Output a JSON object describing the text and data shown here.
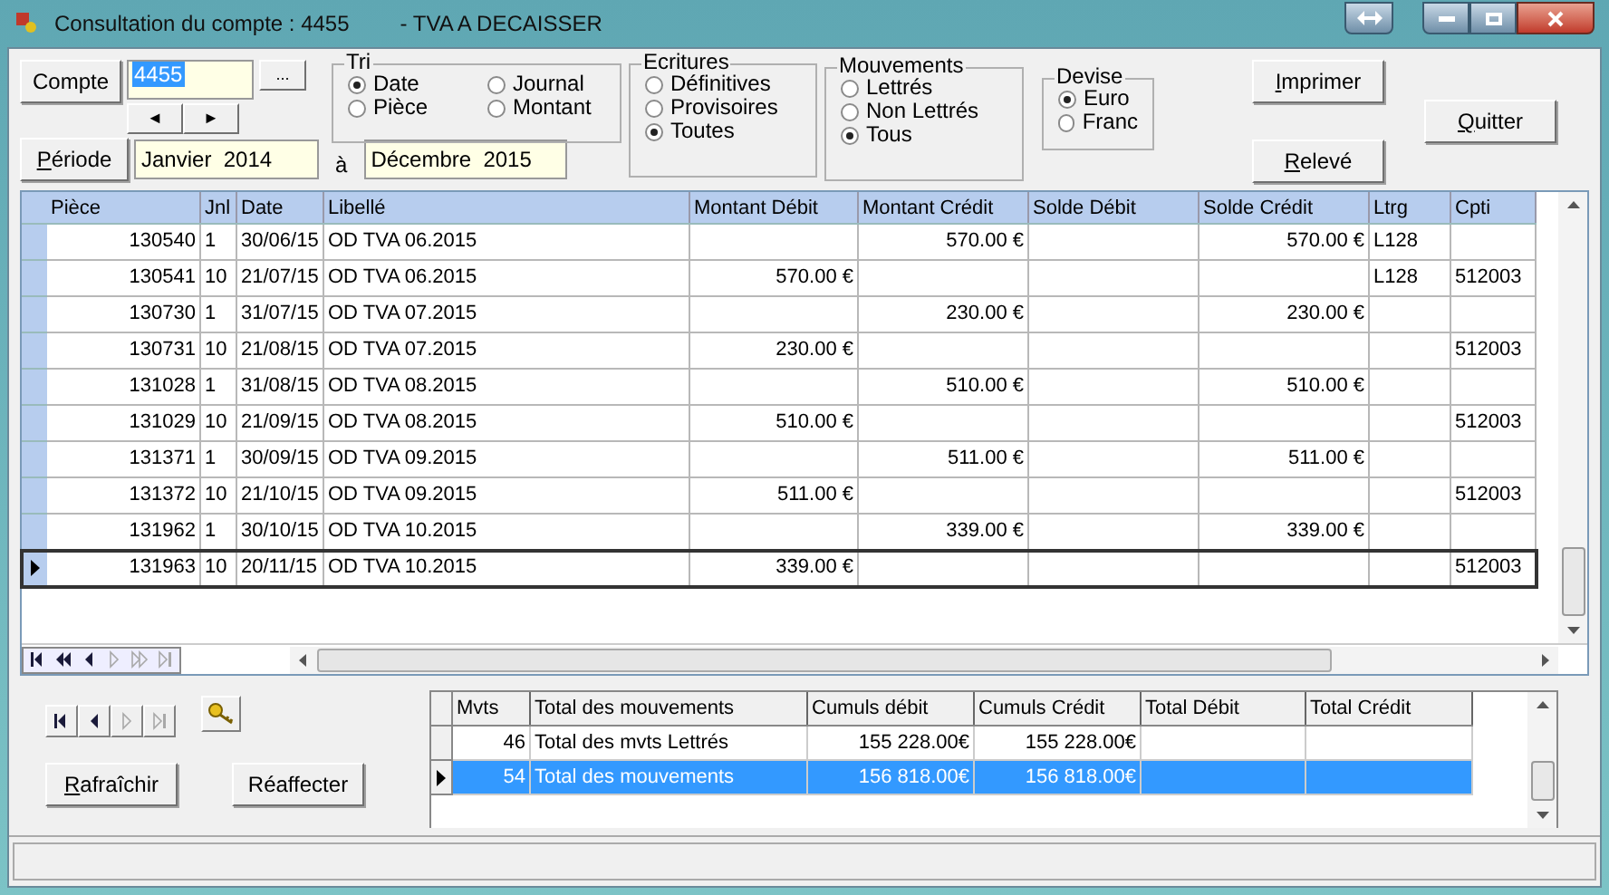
{
  "window": {
    "title": "Consultation du compte : 4455",
    "subtitle": "- TVA A DECAISSER"
  },
  "compte": {
    "button": {
      "label": "Compte",
      "mnemonic": false
    },
    "value": "4455",
    "text_selected": true,
    "browse": "...",
    "prev": "◄",
    "next": "►"
  },
  "periode": {
    "button": {
      "label": "Période",
      "mnemonic": true
    },
    "from": "Janvier  2014",
    "separator": "à",
    "to": "Décembre  2015"
  },
  "tri": {
    "title": "Tri",
    "options": [
      {
        "label": "Date",
        "selected": true
      },
      {
        "label": "Journal",
        "selected": false
      },
      {
        "label": "Pièce",
        "selected": false
      },
      {
        "label": "Montant",
        "selected": false
      }
    ]
  },
  "ecritures": {
    "title": "Ecritures",
    "options": [
      {
        "label": "Définitives",
        "selected": false
      },
      {
        "label": "Provisoires",
        "selected": false
      },
      {
        "label": "Toutes",
        "selected": true
      }
    ]
  },
  "mouvements": {
    "title": "Mouvements",
    "options": [
      {
        "label": "Lettrés",
        "selected": false
      },
      {
        "label": "Non Lettrés",
        "selected": false
      },
      {
        "label": "Tous",
        "selected": true
      }
    ]
  },
  "devise": {
    "title": "Devise",
    "options": [
      {
        "label": "Euro",
        "selected": true
      },
      {
        "label": "Franc",
        "selected": false
      }
    ]
  },
  "buttons": [
    {
      "label": "Imprimer",
      "mnemonic": true
    },
    {
      "label": "Relevé",
      "mnemonic": true
    },
    {
      "label": "Quitter",
      "mnemonic": true
    }
  ],
  "table": {
    "columns": [
      {
        "label": "Pièce",
        "kind": "number"
      },
      {
        "label": "Jnl",
        "kind": "text"
      },
      {
        "label": "Date",
        "kind": "text"
      },
      {
        "label": "Libellé",
        "kind": "text"
      },
      {
        "label": "Montant Débit",
        "kind": "number"
      },
      {
        "label": "Montant Crédit",
        "kind": "number"
      },
      {
        "label": "Solde Débit",
        "kind": "number"
      },
      {
        "label": "Solde Crédit",
        "kind": "number"
      },
      {
        "label": "Ltrg",
        "kind": "text"
      },
      {
        "label": "Cpti",
        "kind": "text"
      }
    ],
    "rows": [
      {
        "selected": false,
        "cells": [
          "130540",
          "1",
          "30/06/15",
          "OD TVA 06.2015",
          null,
          "570.00 €",
          null,
          "570.00 €",
          "L128",
          null
        ]
      },
      {
        "selected": false,
        "cells": [
          "130541",
          "10",
          "21/07/15",
          "OD TVA  06.2015",
          "570.00 €",
          null,
          null,
          null,
          "L128",
          "512003"
        ]
      },
      {
        "selected": false,
        "cells": [
          "130730",
          "1",
          "31/07/15",
          "OD TVA 07.2015",
          null,
          "230.00 €",
          null,
          "230.00 €",
          null,
          null
        ]
      },
      {
        "selected": false,
        "cells": [
          "130731",
          "10",
          "21/08/15",
          "OD TVA 07.2015",
          "230.00 €",
          null,
          null,
          null,
          null,
          "512003"
        ]
      },
      {
        "selected": false,
        "cells": [
          "131028",
          "1",
          "31/08/15",
          "OD TVA 08.2015",
          null,
          "510.00 €",
          null,
          "510.00 €",
          null,
          null
        ]
      },
      {
        "selected": false,
        "cells": [
          "131029",
          "10",
          "21/09/15",
          "OD TVA 08.2015",
          "510.00 €",
          null,
          null,
          null,
          null,
          "512003"
        ]
      },
      {
        "selected": false,
        "cells": [
          "131371",
          "1",
          "30/09/15",
          "OD TVA 09.2015",
          null,
          "511.00 €",
          null,
          "511.00 €",
          null,
          null
        ]
      },
      {
        "selected": false,
        "cells": [
          "131372",
          "10",
          "21/10/15",
          "OD TVA 09.2015",
          "511.00 €",
          null,
          null,
          null,
          null,
          "512003"
        ]
      },
      {
        "selected": false,
        "cells": [
          "131962",
          "1",
          "30/10/15",
          "OD TVA 10.2015",
          null,
          "339.00 €",
          null,
          "339.00 €",
          null,
          null
        ]
      },
      {
        "selected": true,
        "cells": [
          "131963",
          "10",
          "20/11/15",
          "OD TVA 10.2015",
          "339.00 €",
          null,
          null,
          null,
          null,
          "512003"
        ]
      }
    ],
    "navigator": [
      {
        "kind": "first",
        "disabled": false
      },
      {
        "kind": "page-prev",
        "disabled": false
      },
      {
        "kind": "prev",
        "disabled": false
      },
      {
        "kind": "next",
        "disabled": true
      },
      {
        "kind": "page-next",
        "disabled": true
      },
      {
        "kind": "last",
        "disabled": true
      }
    ]
  },
  "record_nav": [
    {
      "kind": "first",
      "disabled": false
    },
    {
      "kind": "prev",
      "disabled": false
    },
    {
      "kind": "next",
      "disabled": true
    },
    {
      "kind": "last",
      "disabled": true
    }
  ],
  "actions": [
    {
      "label": "Rafraîchir",
      "mnemonic": true
    },
    {
      "label": "Réaffecter",
      "mnemonic": false
    }
  ],
  "summary": {
    "columns": [
      {
        "label": "Mvts",
        "kind": "number"
      },
      {
        "label": "Total des mouvements",
        "kind": "text"
      },
      {
        "label": "Cumuls débit",
        "kind": "number"
      },
      {
        "label": "Cumuls Crédit",
        "kind": "number"
      },
      {
        "label": "Total Débit",
        "kind": "number"
      },
      {
        "label": "Total Crédit",
        "kind": "number"
      }
    ],
    "rows": [
      {
        "selected": false,
        "cells": [
          "46",
          "Total des mvts Lettrés",
          "155 228.00€",
          "155 228.00€",
          null,
          null
        ]
      },
      {
        "selected": true,
        "cells": [
          "54",
          "Total des mouvements",
          "156 818.00€",
          "156 818.00€",
          null,
          null
        ]
      }
    ]
  }
}
